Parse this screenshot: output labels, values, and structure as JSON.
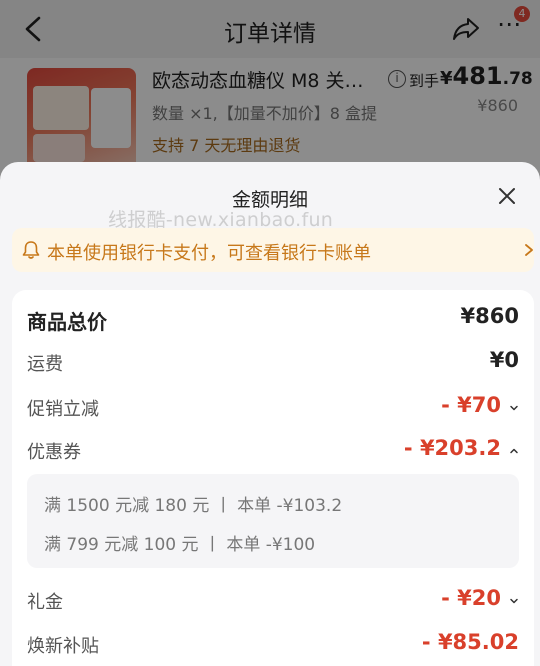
{
  "nav": {
    "title": "订单详情",
    "badge_count": "4"
  },
  "product": {
    "name": "欧态动态血糖仪 M8 关…",
    "info_glyph": "i",
    "price_label": "到手",
    "price_symbol": "¥",
    "price_int": "481",
    "price_dec": ".78",
    "original_price": "¥860",
    "quantity_text": "数量 ×1,【加量不加价】8 盒提",
    "return_policy": "支持 7 天无理由退货"
  },
  "sheet": {
    "title": "金额明细",
    "watermark": "线报酷-new.xianbao.fun",
    "notice": "本单使用银行卡支付，可查看银行卡账单",
    "total_label": "商品总价",
    "total_value": "¥860",
    "shipping_label": "运费",
    "shipping_value": "¥0",
    "promo_label": "促销立减",
    "promo_value": "- ¥70",
    "coupon_label": "优惠券",
    "coupon_value": "- ¥203.2",
    "coupons": [
      "满 1500 元减 180 元  丨 本单 -¥103.2",
      "满 799 元减 100 元  丨 本单 -¥100"
    ],
    "gift_label": "礼金",
    "gift_value": "- ¥20",
    "subsidy_label": "焕新补贴",
    "subsidy_value": "- ¥85.02"
  },
  "colors": {
    "accent_red": "#d9402b",
    "notice_text": "#c7781a",
    "notice_bg": "#fef6e6"
  },
  "icons": [
    "back-arrow-icon",
    "share-icon",
    "more-icon",
    "info-icon",
    "close-icon",
    "bell-icon",
    "chevron-right-icon",
    "chevron-down-icon",
    "chevron-up-icon"
  ]
}
